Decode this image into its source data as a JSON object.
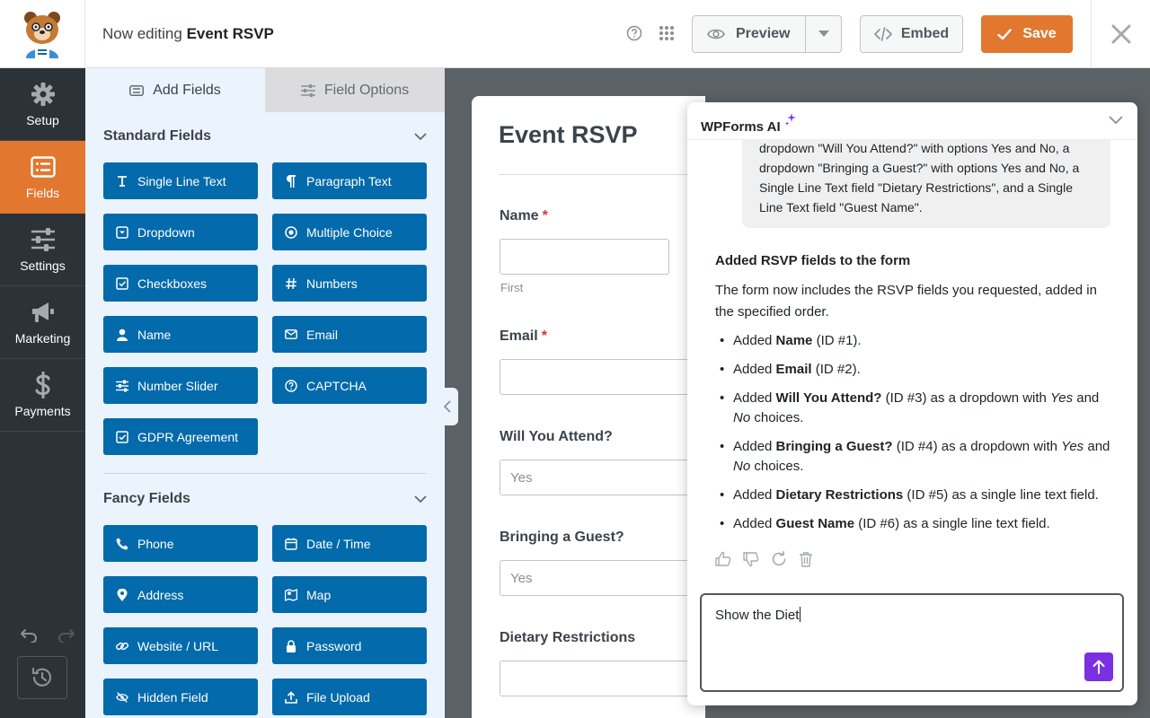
{
  "header": {
    "editing_prefix": "Now editing",
    "form_name": "Event RSVP",
    "preview_label": "Preview",
    "embed_label": "Embed",
    "save_label": "Save"
  },
  "nav": {
    "items": [
      {
        "label": "Setup",
        "icon": "gear-icon"
      },
      {
        "label": "Fields",
        "icon": "fields-list-icon"
      },
      {
        "label": "Settings",
        "icon": "sliders-icon"
      },
      {
        "label": "Marketing",
        "icon": "megaphone-icon"
      },
      {
        "label": "Payments",
        "icon": "dollar-icon"
      }
    ]
  },
  "panel": {
    "tab_add": "Add Fields",
    "tab_options": "Field Options",
    "standard_title": "Standard Fields",
    "fancy_title": "Fancy Fields",
    "standard_fields": [
      {
        "label": "Single Line Text",
        "icon": "text-line-icon"
      },
      {
        "label": "Paragraph Text",
        "icon": "paragraph-icon"
      },
      {
        "label": "Dropdown",
        "icon": "dropdown-icon"
      },
      {
        "label": "Multiple Choice",
        "icon": "radio-icon"
      },
      {
        "label": "Checkboxes",
        "icon": "checkbox-icon"
      },
      {
        "label": "Numbers",
        "icon": "hash-icon"
      },
      {
        "label": "Name",
        "icon": "person-icon"
      },
      {
        "label": "Email",
        "icon": "envelope-icon"
      },
      {
        "label": "Number Slider",
        "icon": "sliders-icon"
      },
      {
        "label": "CAPTCHA",
        "icon": "question-icon"
      },
      {
        "label": "GDPR Agreement",
        "icon": "checkbox-icon"
      }
    ],
    "fancy_fields": [
      {
        "label": "Phone",
        "icon": "phone-icon"
      },
      {
        "label": "Date / Time",
        "icon": "calendar-icon"
      },
      {
        "label": "Address",
        "icon": "map-pin-icon"
      },
      {
        "label": "Map",
        "icon": "map-icon"
      },
      {
        "label": "Website / URL",
        "icon": "link-icon"
      },
      {
        "label": "Password",
        "icon": "lock-icon"
      },
      {
        "label": "Hidden Field",
        "icon": "eye-slash-icon"
      },
      {
        "label": "File Upload",
        "icon": "upload-icon"
      }
    ]
  },
  "form": {
    "title": "Event RSVP",
    "name_label": "Name",
    "name_sublabel": "First",
    "email_label": "Email",
    "attend_label": "Will You Attend?",
    "attend_value": "Yes",
    "guest_label": "Bringing a Guest?",
    "guest_value": "Yes",
    "dietary_label": "Dietary Restrictions",
    "required_mark": "*"
  },
  "ai": {
    "title": "WPForms AI",
    "user_message": "dropdown \"Will You Attend?\" with options Yes and No, a dropdown \"Bringing a Guest?\" with options Yes and No, a Single Line Text field \"Dietary Restrictions\", and a Single Line Text field \"Guest Name\".",
    "response_title": "Added RSVP fields to the form",
    "response_intro": "The form now includes the RSVP fields you requested, added in the specified order.",
    "bullets": {
      "b1": {
        "pre": "Added ",
        "bold": "Name",
        "post": " (ID #1)."
      },
      "b2": {
        "pre": "Added ",
        "bold": "Email",
        "post": " (ID #2)."
      },
      "b3": {
        "pre": "Added ",
        "bold": "Will You Attend?",
        "mid": " (ID #3) as a dropdown with ",
        "i1": "Yes",
        "and": " and ",
        "i2": "No",
        "end": " choices."
      },
      "b4": {
        "pre": "Added ",
        "bold": "Bringing a Guest?",
        "mid": " (ID #4) as a dropdown with ",
        "i1": "Yes",
        "and": " and ",
        "i2": "No",
        "end": " choices."
      },
      "b5": {
        "pre": "Added ",
        "bold": "Dietary Restrictions",
        "post": " (ID #5) as a single line text field."
      },
      "b6": {
        "pre": "Added ",
        "bold": "Guest Name",
        "post": " (ID #6) as a single line text field."
      }
    },
    "input_value": "Show the Diet"
  },
  "colors": {
    "accent": "#e27730",
    "field_button": "#036aab",
    "ai_send": "#7a30e2",
    "nav_bg": "#2c3338"
  }
}
